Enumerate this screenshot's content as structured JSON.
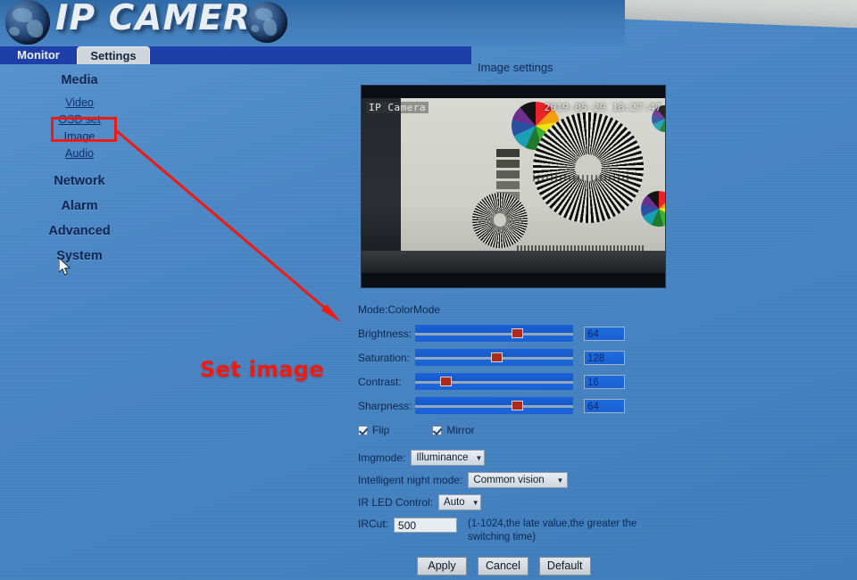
{
  "header": {
    "brand": "IP CAMERA",
    "globe_left_icon": "globe-icon",
    "globe_right_icon": "globe-icon"
  },
  "tabs": [
    {
      "label": "Monitor",
      "active": false
    },
    {
      "label": "Settings",
      "active": true
    }
  ],
  "sidebar": {
    "groups": [
      {
        "label": "Media",
        "children": [
          {
            "label": "Video"
          },
          {
            "label": "OSD set"
          },
          {
            "label": "Image"
          },
          {
            "label": "Audio"
          }
        ]
      },
      {
        "label": "Network",
        "children": []
      },
      {
        "label": "Alarm",
        "children": []
      },
      {
        "label": "Advanced",
        "children": []
      },
      {
        "label": "System",
        "children": []
      }
    ]
  },
  "annotation": {
    "text": "Set image",
    "color": "#ee1b11"
  },
  "main": {
    "title": "Image settings",
    "video": {
      "osd_name": "IP Camera",
      "osd_timestamp": "2019-05-29 18:27:47"
    },
    "mode_line": "Mode:ColorMode",
    "sliders": [
      {
        "label": "Brightness:",
        "value": "64",
        "percent": 61
      },
      {
        "label": "Saturation:",
        "value": "128",
        "percent": 48
      },
      {
        "label": "Contrast:",
        "value": "16",
        "percent": 16
      },
      {
        "label": "Sharpness:",
        "value": "64",
        "percent": 61
      }
    ],
    "checkboxes": [
      {
        "label": "Flip",
        "checked": true
      },
      {
        "label": "Mirror",
        "checked": true
      }
    ],
    "imgmode": {
      "label": "Imgmode:",
      "value": "Illuminance"
    },
    "night_mode": {
      "label": "Intelligent night mode:",
      "value": "Common vision"
    },
    "ir_led": {
      "label": "IR LED Control:",
      "value": "Auto"
    },
    "ircut": {
      "label": "IRCut:",
      "value": "500",
      "hint": "(1-1024,the late value,the greater the switching time)"
    },
    "buttons": [
      {
        "label": "Apply"
      },
      {
        "label": "Cancel"
      },
      {
        "label": "Default"
      }
    ]
  }
}
